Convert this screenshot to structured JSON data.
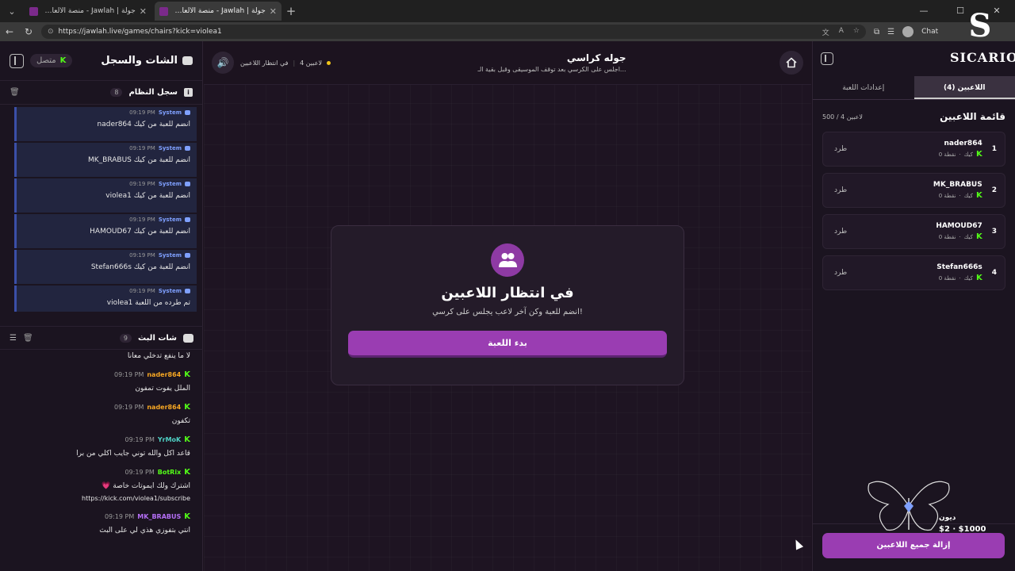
{
  "browser": {
    "tabs": [
      {
        "title": "جولة | Jawlah - منصة الألعاب التفا..."
      },
      {
        "title": "جولة | Jawlah - منصة الألعاب التفا..."
      }
    ],
    "url": "https://jawlah.live/games/chairs?kick=violea1",
    "chat_button": "Chat"
  },
  "left": {
    "title": "الشات والسجل",
    "status": "متصل",
    "system_log": {
      "label": "سجل النظام",
      "count": "8",
      "entries": [
        {
          "sender": "System",
          "time": "09:19 PM",
          "text": "nader864 انضم للعبة من كيك"
        },
        {
          "sender": "System",
          "time": "09:19 PM",
          "text": "MK_BRABUS انضم للعبة من كيك"
        },
        {
          "sender": "System",
          "time": "09:19 PM",
          "text": "violea1 انضم للعبة من كيك"
        },
        {
          "sender": "System",
          "time": "09:19 PM",
          "text": "HAMOUD67 انضم للعبة من كيك"
        },
        {
          "sender": "System",
          "time": "09:19 PM",
          "text": "Stefan666s انضم للعبة من كيك"
        },
        {
          "sender": "System",
          "time": "09:19 PM",
          "text": "violea1 تم طرده من اللعبة"
        }
      ]
    },
    "stream_chat": {
      "label": "شات البث",
      "count": "9",
      "messages": [
        {
          "name": "",
          "time": "",
          "text": "لا ما ينفع تدخلي معانا",
          "color": "#ffffff"
        },
        {
          "name": "nader864",
          "time": "09:19 PM",
          "text": "الملل يفوت تمفون",
          "color": "#f5a623"
        },
        {
          "name": "nader864",
          "time": "09:19 PM",
          "text": "تكفون",
          "color": "#f5a623"
        },
        {
          "name": "YrMoK",
          "time": "09:19 PM",
          "text": "قاعد اكل والله توني جايب اكلي من برا",
          "color": "#4fd1c5"
        },
        {
          "name": "BotRix",
          "time": "09:19 PM",
          "text": "💗 اشترك ولك ايموتات خاصة",
          "text2": "https://kick.com/violea1/subscribe",
          "color": "#53fc18"
        },
        {
          "name": "MK_BRABUS",
          "time": "09:19 PM",
          "text": "انتي بتفوزي هذي لي على البث",
          "color": "#b46ef5"
        }
      ]
    }
  },
  "center": {
    "game_title": "جوله كراسي",
    "game_desc": "اجلس على الكرسي بعد توقف الموسيقى وقبل بقية الـ...",
    "player_count": "4 لاعبين",
    "state": "في انتظار اللاعبين",
    "card_title": "في انتظار اللاعبين",
    "card_sub": "انضم للعبة وكن آخر لاعب يجلس على كرسي!",
    "start_button": "بدء اللعبة"
  },
  "right": {
    "tabs": [
      "اللاعبين (4)",
      "إعدادات اللعبة"
    ],
    "list_title": "قائمة اللاعبين",
    "list_count": "500 / 4 لاعبين",
    "players": [
      {
        "rank": "1",
        "name": "nader864",
        "meta": "0 نقطة",
        "platform": "كيك",
        "kick_label": "طرد"
      },
      {
        "rank": "2",
        "name": "MK_BRABUS",
        "meta": "0 نقطة",
        "platform": "كيك",
        "kick_label": "طرد"
      },
      {
        "rank": "3",
        "name": "HAMOUD67",
        "meta": "0 نقطة",
        "platform": "كيك",
        "kick_label": "طرد"
      },
      {
        "rank": "4",
        "name": "Stefan666s",
        "meta": "0 نقطة",
        "platform": "كيك",
        "kick_label": "طرد"
      }
    ],
    "remove_all": "إزالة جميع اللاعبين"
  },
  "overlay": {
    "logo_letter": "S",
    "logo_name": "SICARIO",
    "donation_name": "ديون",
    "donation_amount": "$2 · $1000"
  },
  "colors": {
    "accent": "#9a3db2",
    "kick_green": "#53fc18",
    "system_blue": "#7fa0ff"
  }
}
